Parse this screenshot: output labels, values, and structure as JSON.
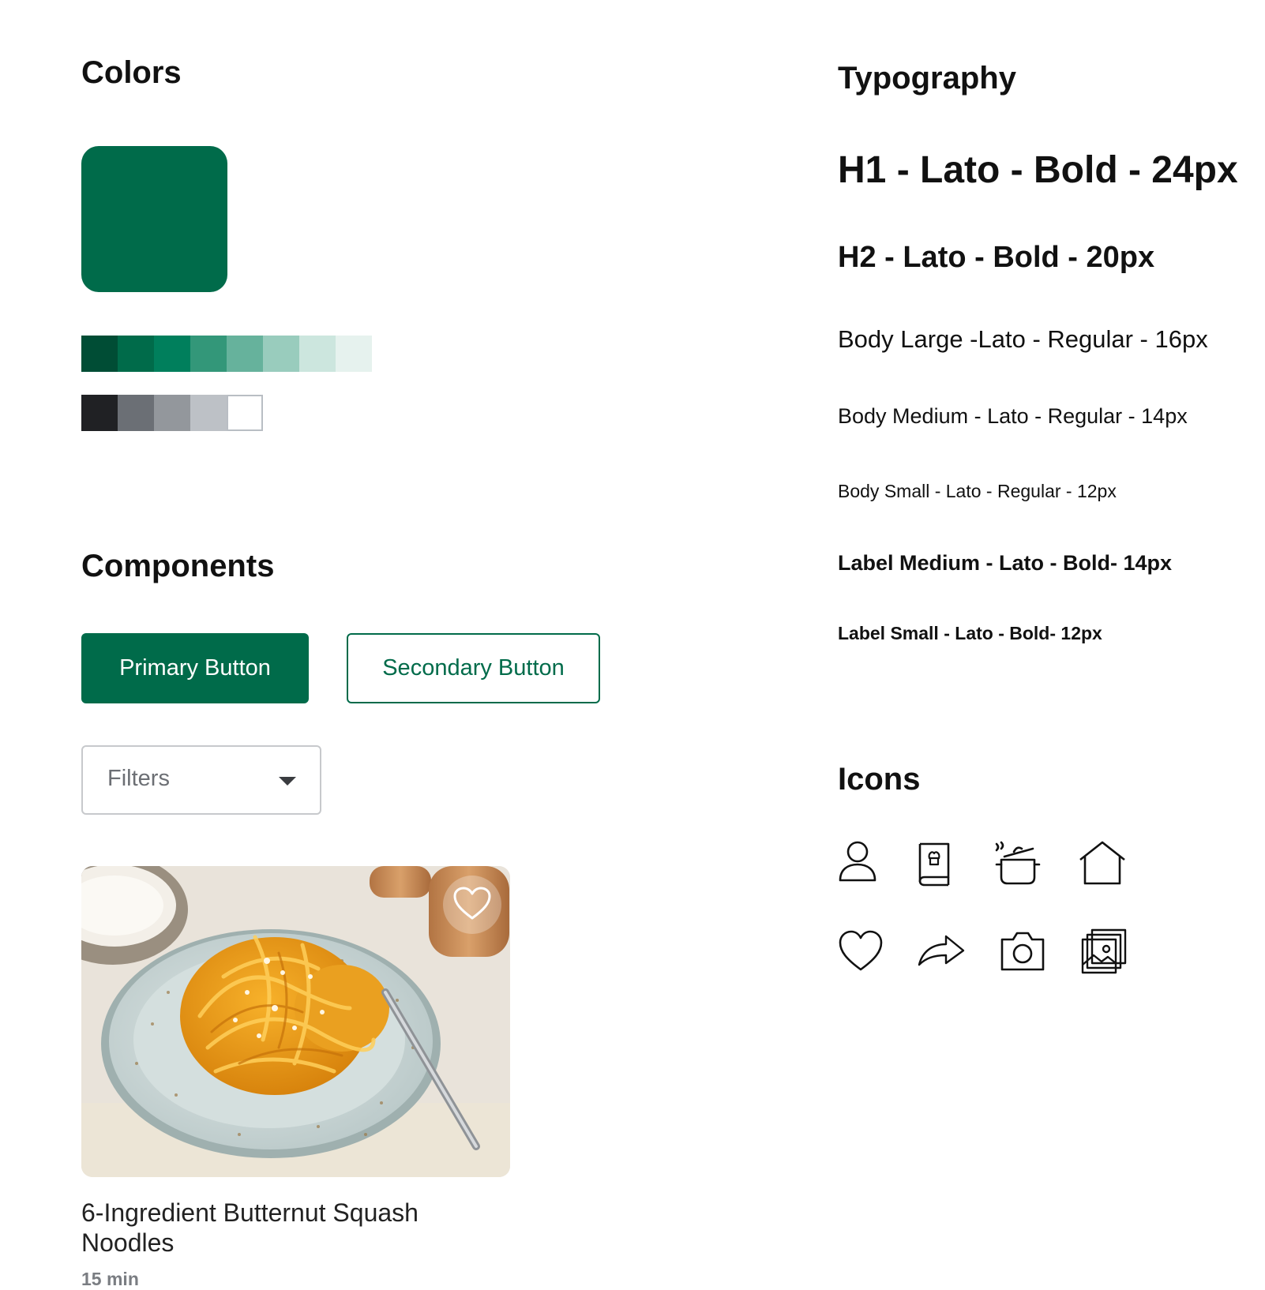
{
  "sections": {
    "colors": "Colors",
    "components": "Components",
    "typography": "Typography",
    "icons": "Icons"
  },
  "colors": {
    "brand": "#006B4A",
    "green_scale": [
      "#004D35",
      "#006B4A",
      "#007F5C",
      "#339779",
      "#66B29C",
      "#99CCBD",
      "#CCE6DE",
      "#E6F2EE"
    ],
    "neutral_scale": [
      "#202124",
      "#6B6F75",
      "#93979C",
      "#BDC1C6",
      "#FFFFFF"
    ]
  },
  "typography": {
    "h1": "H1 - Lato - Bold - 24px",
    "h2": "H2 - Lato - Bold - 20px",
    "body_large": "Body Large -Lato - Regular - 16px",
    "body_medium": "Body Medium - Lato - Regular - 14px",
    "body_small": "Body Small - Lato - Regular - 12px",
    "label_medium": "Label Medium - Lato - Bold- 14px",
    "label_small": "Label Small - Lato - Bold- 12px"
  },
  "components": {
    "primary_button": "Primary Button",
    "secondary_button": "Secondary Button",
    "filters": {
      "value": "Filters"
    },
    "recipe_card": {
      "title": "6-Ingredient Butternut Squash Noodles",
      "time": "15 min",
      "image": "butternut-squash-noodles-photo",
      "favorite_icon": "heart-outline-icon"
    }
  },
  "icons": [
    "user-icon",
    "cookbook-icon",
    "cooking-pot-icon",
    "home-icon",
    "heart-icon",
    "share-arrow-icon",
    "camera-icon",
    "image-gallery-icon"
  ]
}
